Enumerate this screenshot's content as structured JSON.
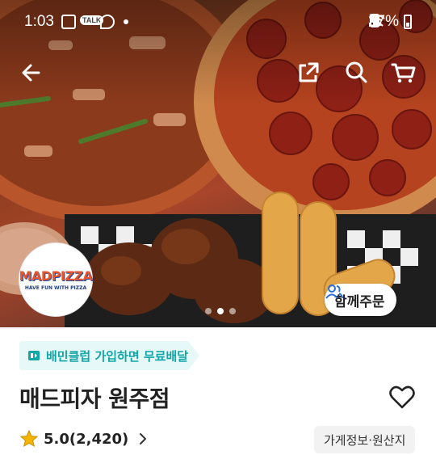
{
  "status_bar": {
    "time": "1:03",
    "battery": "37%",
    "talk_badge": "TALK"
  },
  "colors": {
    "accent_teal": "#12a5a5",
    "promo_bg": "#e7f8f8",
    "star": "#f5b400",
    "group_icon": "#2a6fd6"
  },
  "nav": {
    "back_icon": "arrow-left-icon",
    "share_icon": "share-icon",
    "search_icon": "search-icon",
    "cart_icon": "cart-icon"
  },
  "hero": {
    "logo_text": "MADPIZZA",
    "logo_tagline": "HAVE FUN WITH PIZZA",
    "carousel_active_index": 1,
    "carousel_count": 3,
    "group_order_label": "함께주문"
  },
  "promo": {
    "label": "배민클럽 가입하면 무료배달"
  },
  "store": {
    "name": "매드피자 원주점",
    "rating": "5.0(2,420)",
    "info_button": "가게정보·원산지"
  }
}
